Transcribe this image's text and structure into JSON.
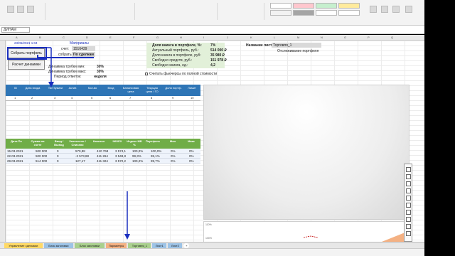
{
  "formula_bar": {
    "name_box": "ДИНАМ"
  },
  "columns": [
    "A",
    "B",
    "C",
    "D",
    "E",
    "F",
    "G",
    "H",
    "I",
    "J",
    "K",
    "L",
    "M",
    "N",
    "O",
    "P",
    "Q"
  ],
  "date_cell": "23/05/2021 1:04",
  "buttons": {
    "collect": "Собрать портфель",
    "dynamics": "Расчет динамики"
  },
  "params": {
    "title": "Материалы",
    "account_label": "счет:",
    "account_value": "1516439",
    "collect_label": "собрать:",
    "collect_value": "По сделкам",
    "dyn_max_label": "Динамика трубки мин:",
    "dyn_max_value": "30%",
    "dyn_min_label": "Динамика трубки макс:",
    "dyn_min_value": "30%",
    "period_label": "Период отметок:",
    "period_value": "неделя"
  },
  "summary": {
    "rows": [
      {
        "label": "Доля книнга в портфеле, %:",
        "value": "7%"
      },
      {
        "label": "Актуальный портфель, руб.:",
        "value": "514 000 ₽"
      },
      {
        "label": "Доля книнга в портфеле, руб:",
        "value": "35 980 ₽"
      },
      {
        "label": "Свободно средств, руб.:",
        "value": "151 978 ₽"
      },
      {
        "label": "Свободно книнга, ед.:",
        "value": "4,2"
      }
    ],
    "checkbox_label": "Считать фьючерсы по полной стоимости"
  },
  "sheet_info": {
    "label": "Название листа:",
    "value": "Торговля_1",
    "sub": "Отслеживание портфеля"
  },
  "blue_header": [
    "ID",
    "Дата входа",
    "Тип бумаги",
    "Актив",
    "Кол-во",
    "Вход",
    "Балансовая цена",
    "Текущая цена / ГО",
    "Доля портф.",
    "Лимит"
  ],
  "index_row": [
    "1",
    "2",
    "3",
    "4",
    "5",
    "6",
    "7",
    "8",
    "9",
    "10"
  ],
  "green_header": [
    "Дата По",
    "Сумма на счете",
    "Ввод / Вывод",
    "Зачислено / Списано",
    "Капитал",
    "IMOEX",
    "Индекс МБ %",
    "Портфель",
    "Мин",
    "Макс"
  ],
  "table_rows": [
    [
      "15.03.2021",
      "500 000",
      "0",
      "570,88",
      "410 768",
      "3 574,1",
      "100,0%",
      "100,0%",
      "0%",
      "0%"
    ],
    [
      "22.03.2021",
      "500 000",
      "0",
      "-2 573,88",
      "411 264",
      "3 548,8",
      "99,3%",
      "95,1%",
      "0%",
      "0%"
    ],
    [
      "29.03.2021",
      "514 000",
      "0",
      "127,17",
      "411 324",
      "3 572,2",
      "100,2%",
      "99,7%",
      "0%",
      "0%"
    ]
  ],
  "tabs": [
    {
      "label": "Управление сделками",
      "color": "#ffd966"
    },
    {
      "label": "Блок заголовки",
      "color": "#9dc3e6"
    },
    {
      "label": "Блок заголовки",
      "color": "#a9d08e"
    },
    {
      "label": "Параметры",
      "color": "#f4b183"
    },
    {
      "label": "Торговля_1",
      "color": "#a9d08e"
    },
    {
      "label": "Лист1",
      "color": "#9dc3e6"
    },
    {
      "label": "Лист2",
      "color": "#9dc3e6"
    }
  ],
  "chart_axis": {
    "top": "110%",
    "bottom": "100%"
  },
  "colors": {
    "blue_header": "#2e75b6",
    "green_header": "#70ad47",
    "annotation": "#1a2fbf"
  }
}
